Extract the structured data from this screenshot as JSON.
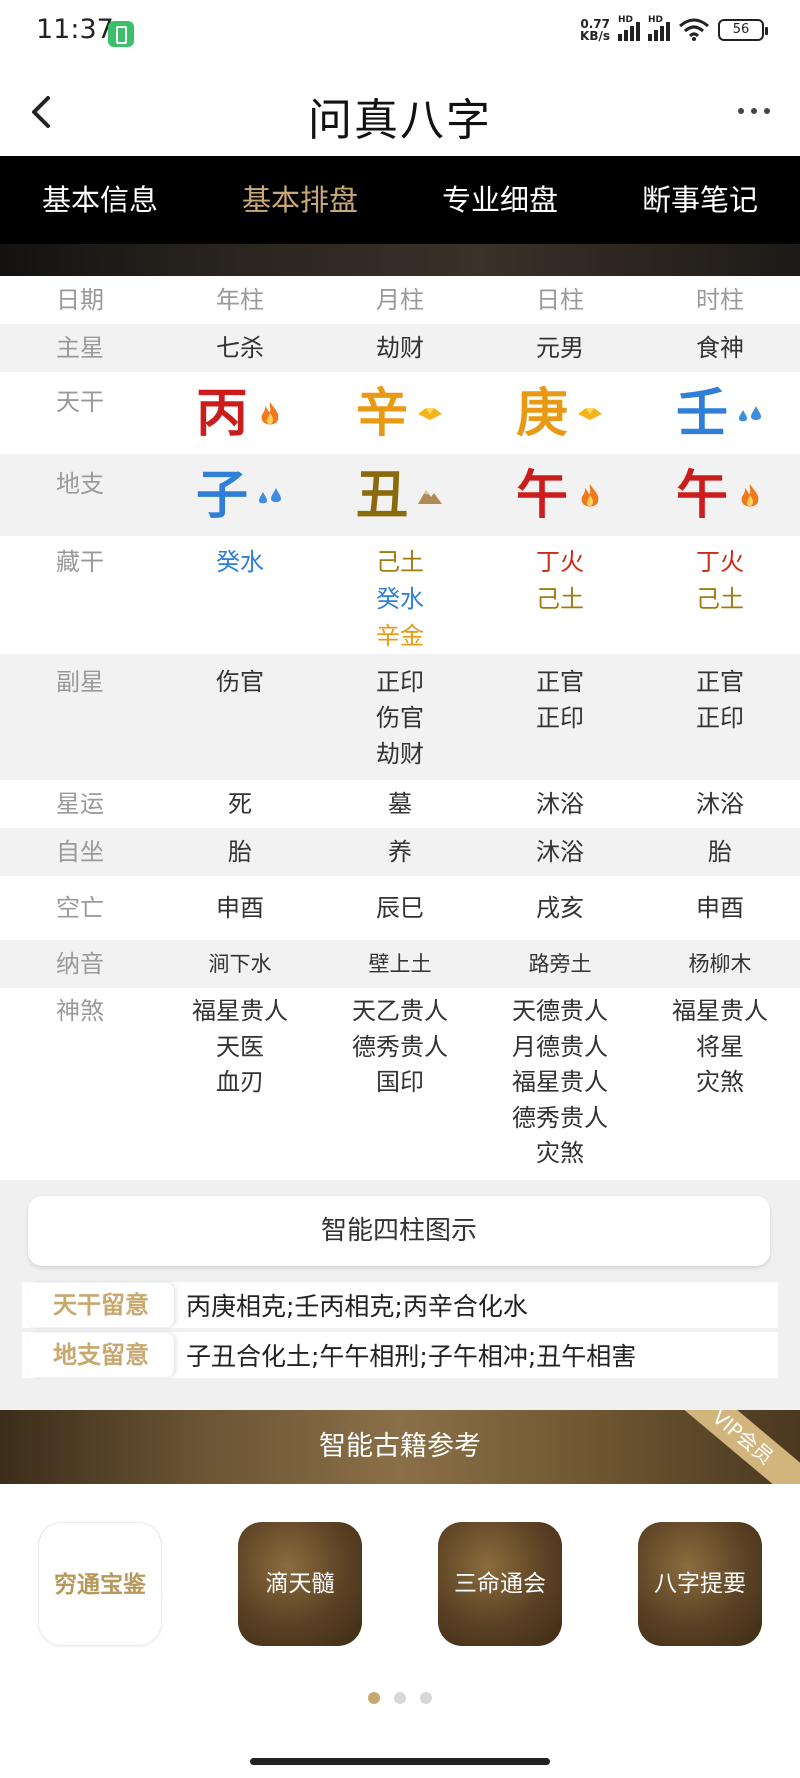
{
  "status_bar": {
    "time": "11:37",
    "speed_top": "0.77",
    "speed_bottom": "KB/s",
    "sig1": "HD",
    "sig2": "HD",
    "battery": "56"
  },
  "app": {
    "title": "问真八字"
  },
  "tabs": [
    "基本信息",
    "基本排盘",
    "专业细盘",
    "断事笔记"
  ],
  "active_tab": "基本排盘",
  "chart": {
    "header": {
      "label": "日期",
      "cols": [
        "年柱",
        "月柱",
        "日柱",
        "时柱"
      ]
    },
    "main_star": {
      "label": "主星",
      "cols": [
        "七杀",
        "劫财",
        "元男",
        "食神"
      ]
    },
    "heavenly_stems": {
      "label": "天干",
      "chars": [
        "丙",
        "辛",
        "庚",
        "壬"
      ],
      "elements": [
        "fire",
        "metal",
        "metal",
        "water"
      ],
      "colors": [
        "#cc1d1d",
        "#e99a14",
        "#e99a14",
        "#2f7fd8"
      ]
    },
    "earthly_branches": {
      "label": "地支",
      "chars": [
        "子",
        "丑",
        "午",
        "午"
      ],
      "elements": [
        "water",
        "earth",
        "fire",
        "fire"
      ],
      "colors": [
        "#2f7fd8",
        "#8a6a0a",
        "#cc1d1d",
        "#cc1d1d"
      ]
    },
    "hidden_stems": {
      "label": "藏干",
      "cols": [
        [
          "癸水"
        ],
        [
          "己土",
          "癸水",
          "辛金"
        ],
        [
          "丁火",
          "己土"
        ],
        [
          "丁火",
          "己土"
        ]
      ]
    },
    "sub_star": {
      "label": "副星",
      "cols": [
        [
          "伤官"
        ],
        [
          "正印",
          "伤官",
          "劫财"
        ],
        [
          "正官",
          "正印"
        ],
        [
          "正官",
          "正印"
        ]
      ]
    },
    "star_luck": {
      "label": "星运",
      "cols": [
        "死",
        "墓",
        "沐浴",
        "沐浴"
      ]
    },
    "self_seat": {
      "label": "自坐",
      "cols": [
        "胎",
        "养",
        "沐浴",
        "胎"
      ]
    },
    "void": {
      "label": "空亡",
      "cols": [
        "申酉",
        "辰巳",
        "戌亥",
        "申酉"
      ]
    },
    "nayin": {
      "label": "纳音",
      "cols": [
        "涧下水",
        "壁上土",
        "路旁土",
        "杨柳木"
      ]
    },
    "shensha": {
      "label": "神煞",
      "cols": [
        [
          "福星贵人",
          "天医",
          "血刃"
        ],
        [
          "天乙贵人",
          "德秀贵人",
          "国印"
        ],
        [
          "天德贵人",
          "月德贵人",
          "福星贵人",
          "德秀贵人",
          "灾煞"
        ],
        [
          "福星贵人",
          "将星",
          "灾煞"
        ]
      ]
    }
  },
  "smart_pillars_button": "智能四柱图示",
  "notices": [
    {
      "tag": "天干留意",
      "text": "丙庚相克;壬丙相克;丙辛合化水"
    },
    {
      "tag": "地支留意",
      "text": "子丑合化土;午午相刑;子午相冲;丑午相害"
    }
  ],
  "banner": {
    "title": "智能古籍参考",
    "badge": "VIP会员"
  },
  "books": [
    "穷通宝鉴",
    "滴天髓",
    "三命通会",
    "八字提要"
  ],
  "pager": {
    "count": 3,
    "active": 0
  }
}
